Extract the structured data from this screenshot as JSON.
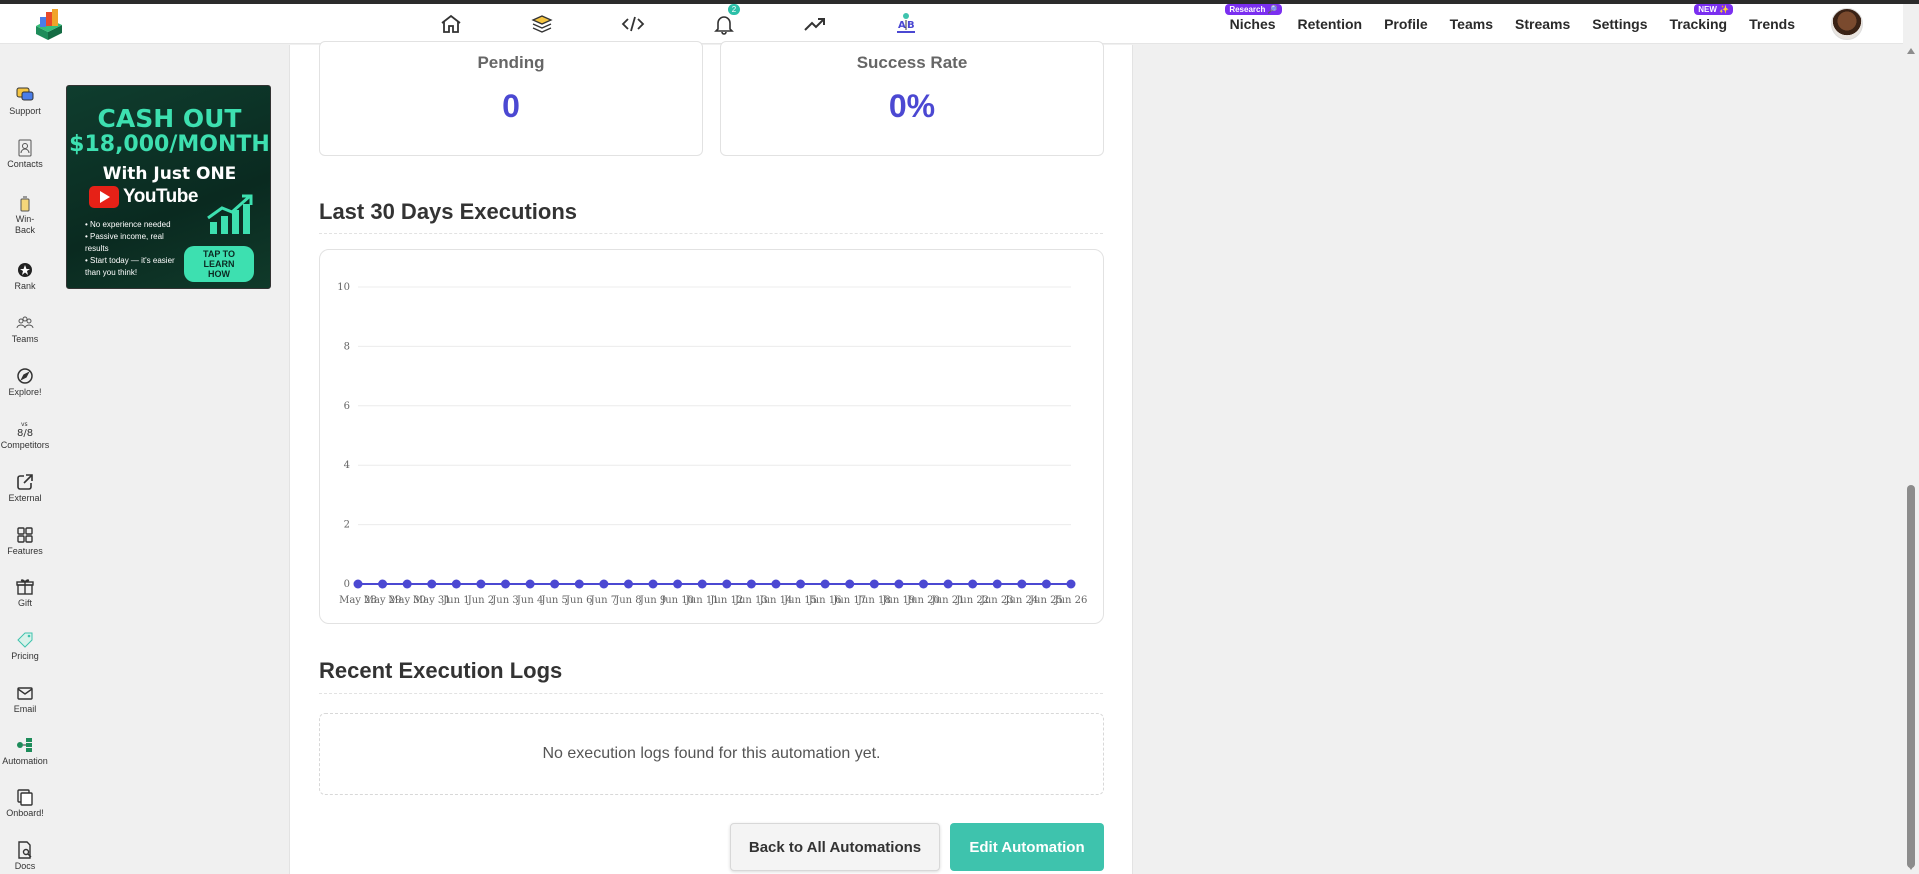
{
  "topbar": {
    "center_icons": [
      {
        "name": "home-icon"
      },
      {
        "name": "layers-icon"
      },
      {
        "name": "code-icon"
      },
      {
        "name": "bell-icon",
        "badge": "2"
      },
      {
        "name": "trending-icon"
      },
      {
        "name": "ab-test-icon"
      }
    ],
    "links": [
      {
        "label": "Niches",
        "tag": "Research 🔎"
      },
      {
        "label": "Retention",
        "tag": ""
      },
      {
        "label": "Profile",
        "tag": ""
      },
      {
        "label": "Teams",
        "tag": ""
      },
      {
        "label": "Streams",
        "tag": ""
      },
      {
        "label": "Settings",
        "tag": ""
      },
      {
        "label": "Tracking",
        "tag": "NEW ✨"
      },
      {
        "label": "Trends",
        "tag": ""
      }
    ]
  },
  "sidebar": {
    "items": [
      {
        "label": "Support",
        "icon": "support-icon"
      },
      {
        "label": "Contacts",
        "icon": "contacts-icon"
      },
      {
        "label": "Win-\nBack",
        "icon": "win-back-icon"
      },
      {
        "label": "Rank",
        "icon": "rank-icon"
      },
      {
        "label": "Teams",
        "icon": "teams-icon"
      },
      {
        "label": "Explore!",
        "icon": "explore-icon"
      },
      {
        "label": "Competitors",
        "icon": "competitors-icon"
      },
      {
        "label": "External",
        "icon": "external-icon"
      },
      {
        "label": "Features",
        "icon": "features-icon"
      },
      {
        "label": "Gift",
        "icon": "gift-icon"
      },
      {
        "label": "Pricing",
        "icon": "pricing-icon"
      },
      {
        "label": "Email",
        "icon": "email-icon"
      },
      {
        "label": "Automation",
        "icon": "automation-icon"
      },
      {
        "label": "Onboard!",
        "icon": "onboard-icon"
      },
      {
        "label": "Docs",
        "icon": "docs-icon"
      }
    ]
  },
  "ad": {
    "line1": "CASH OUT",
    "line2": "$18,000/MONTH",
    "line3": "With Just ONE",
    "brand": "YouTube",
    "bullets": [
      "• No experience needed",
      "• Passive income, real results",
      "• Start today — it's easier than you think!"
    ],
    "cta": "TAP TO LEARN HOW"
  },
  "stats": [
    {
      "label": "Pending",
      "value": "0"
    },
    {
      "label": "Success Rate",
      "value": "0%"
    }
  ],
  "executions_title": "Last 30 Days Executions",
  "logs_title": "Recent Execution Logs",
  "logs_empty": "No execution logs found for this automation yet.",
  "buttons": {
    "back": "Back to All Automations",
    "edit": "Edit Automation"
  },
  "colors": {
    "accent": "#4b48d2",
    "teal": "#3ec3ad",
    "tag_purple": "#7b2ff0"
  },
  "chart_data": {
    "type": "line",
    "title": "",
    "xlabel": "",
    "ylabel": "",
    "ylim": [
      0,
      10
    ],
    "yticks": [
      0,
      2,
      4,
      6,
      8,
      10
    ],
    "grid": true,
    "categories": [
      "May 28",
      "May 29",
      "May 30",
      "May 31",
      "Jun 1",
      "Jun 2",
      "Jun 3",
      "Jun 4",
      "Jun 5",
      "Jun 6",
      "Jun 7",
      "Jun 8",
      "Jun 9",
      "Jun 10",
      "Jun 11",
      "Jun 12",
      "Jun 13",
      "Jun 14",
      "Jun 15",
      "Jun 16",
      "Jun 17",
      "Jun 18",
      "Jun 19",
      "Jun 20",
      "Jun 21",
      "Jun 22",
      "Jun 23",
      "Jun 24",
      "Jun 25",
      "Jun 26"
    ],
    "series": [
      {
        "values": [
          0,
          0,
          0,
          0,
          0,
          0,
          0,
          0,
          0,
          0,
          0,
          0,
          0,
          0,
          0,
          0,
          0,
          0,
          0,
          0,
          0,
          0,
          0,
          0,
          0,
          0,
          0,
          0,
          0,
          0
        ],
        "color": "#4b48d2"
      }
    ]
  }
}
